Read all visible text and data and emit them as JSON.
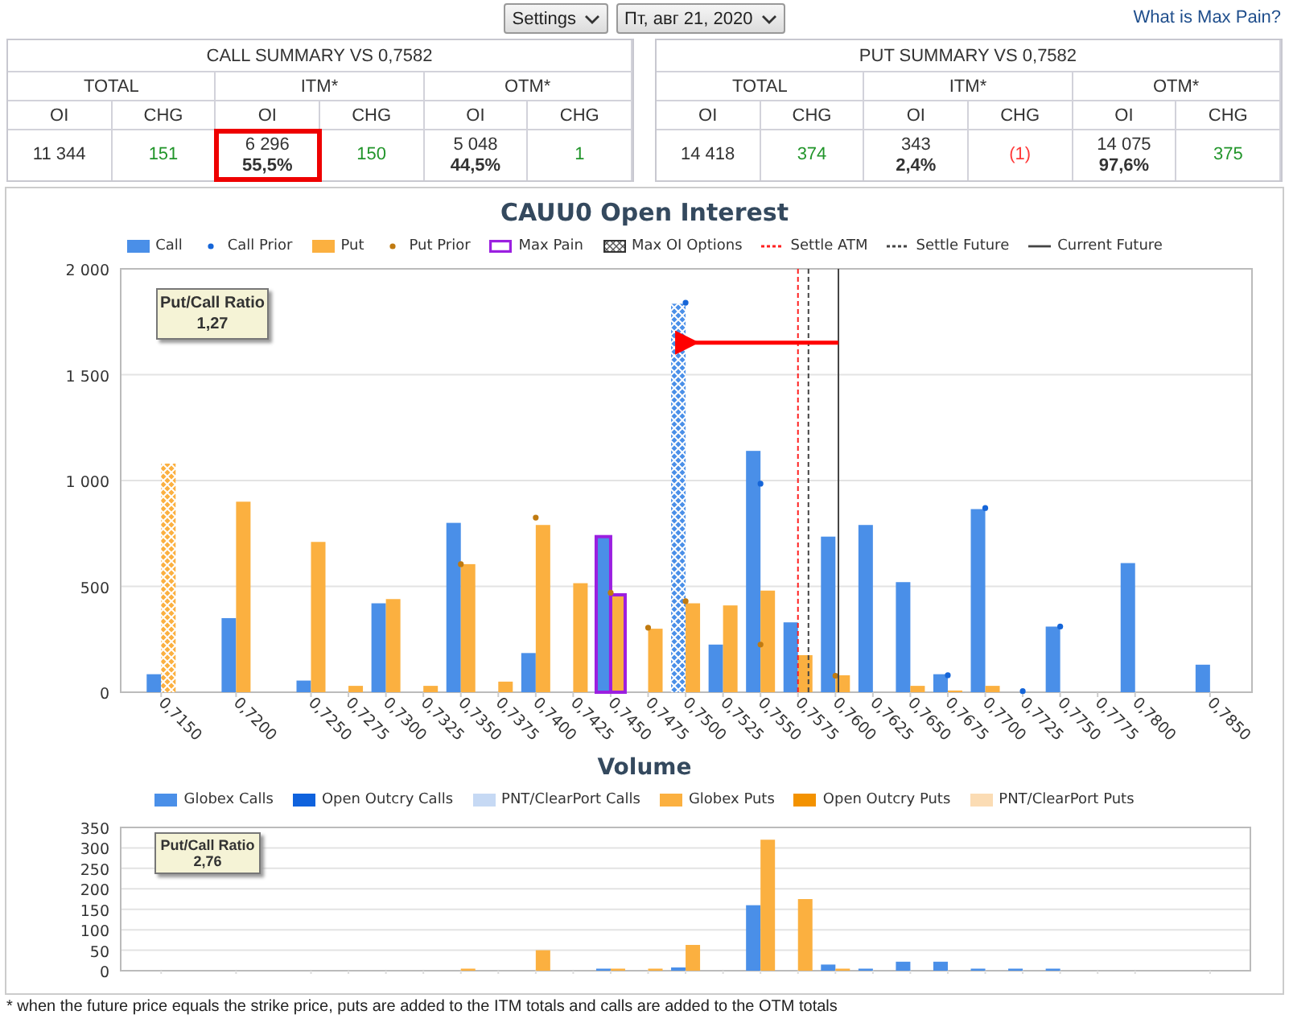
{
  "toolbar": {
    "settings": "Settings",
    "date": "Пт, авг 21, 2020",
    "help_link": "What is Max Pain?"
  },
  "summaries": [
    {
      "title": "CALL SUMMARY VS 0,7582",
      "groups": [
        "TOTAL",
        "ITM*",
        "OTM*"
      ],
      "columns": [
        "OI",
        "CHG",
        "OI",
        "CHG",
        "OI",
        "CHG"
      ],
      "cells": [
        {
          "value": "11 344",
          "color": "#333333",
          "highlighted": false
        },
        {
          "value": "151",
          "color": "#22952b",
          "highlighted": false
        },
        {
          "value": "6 296",
          "share": "55,5%",
          "color": "#333333",
          "highlighted": true
        },
        {
          "value": "150",
          "color": "#22952b",
          "highlighted": false
        },
        {
          "value": "5 048",
          "share": "44,5%",
          "color": "#333333",
          "highlighted": false
        },
        {
          "value": "1",
          "color": "#22952b",
          "highlighted": false
        }
      ]
    },
    {
      "title": "PUT SUMMARY VS 0,7582",
      "groups": [
        "TOTAL",
        "ITM*",
        "OTM*"
      ],
      "columns": [
        "OI",
        "CHG",
        "OI",
        "CHG",
        "OI",
        "CHG"
      ],
      "cells": [
        {
          "value": "14 418",
          "color": "#333333",
          "highlighted": false
        },
        {
          "value": "374",
          "color": "#22952b",
          "highlighted": false
        },
        {
          "value": "343",
          "share": "2,4%",
          "color": "#333333",
          "highlighted": false
        },
        {
          "value": "(1)",
          "color": "#ff3b3b",
          "highlighted": false
        },
        {
          "value": "14 075",
          "share": "97,6%",
          "color": "#333333",
          "highlighted": false
        },
        {
          "value": "375",
          "color": "#22952b",
          "highlighted": false
        }
      ]
    }
  ],
  "oi_chart": {
    "legend_extras": [
      {
        "label": "Max Pain",
        "kind": "outline",
        "color": "#9b1fe0"
      },
      {
        "label": "Max OI Options",
        "kind": "hatch",
        "color": "#333333"
      }
    ],
    "ratio": {
      "label": "Put/Call Ratio",
      "value": "1,27"
    },
    "chart_data": {
      "type": "bar",
      "title": "CAUU0 Open Interest",
      "stacked": false,
      "grid": true,
      "x": [
        0.715,
        0.72,
        0.725,
        0.7275,
        0.73,
        0.7325,
        0.735,
        0.7375,
        0.74,
        0.7425,
        0.745,
        0.7475,
        0.75,
        0.7525,
        0.755,
        0.7575,
        0.76,
        0.7625,
        0.765,
        0.7675,
        0.77,
        0.7725,
        0.775,
        0.7775,
        0.78,
        0.785
      ],
      "xlim": [
        0.7123,
        0.7878
      ],
      "xticks": [
        {
          "value": 0.715,
          "label": "0,7150"
        },
        {
          "value": 0.72,
          "label": "0,7200"
        },
        {
          "value": 0.725,
          "label": "0,7250"
        },
        {
          "value": 0.7275,
          "label": "0,7275"
        },
        {
          "value": 0.73,
          "label": "0,7300"
        },
        {
          "value": 0.7325,
          "label": "0,7325"
        },
        {
          "value": 0.735,
          "label": "0,7350"
        },
        {
          "value": 0.7375,
          "label": "0,7375"
        },
        {
          "value": 0.74,
          "label": "0,7400"
        },
        {
          "value": 0.7425,
          "label": "0,7425"
        },
        {
          "value": 0.745,
          "label": "0,7450"
        },
        {
          "value": 0.7475,
          "label": "0,7475"
        },
        {
          "value": 0.75,
          "label": "0,7500"
        },
        {
          "value": 0.7525,
          "label": "0,7525"
        },
        {
          "value": 0.755,
          "label": "0,7550"
        },
        {
          "value": 0.7575,
          "label": "0,7575"
        },
        {
          "value": 0.76,
          "label": "0,7600"
        },
        {
          "value": 0.7625,
          "label": "0,7625"
        },
        {
          "value": 0.765,
          "label": "0,7650"
        },
        {
          "value": 0.7675,
          "label": "0,7675"
        },
        {
          "value": 0.77,
          "label": "0,7700"
        },
        {
          "value": 0.7725,
          "label": "0,7725"
        },
        {
          "value": 0.775,
          "label": "0,7750"
        },
        {
          "value": 0.7775,
          "label": "0,7775"
        },
        {
          "value": 0.78,
          "label": "0,7800"
        },
        {
          "value": 0.785,
          "label": "0,7850"
        }
      ],
      "ylim": [
        0,
        2000
      ],
      "yticks": [
        {
          "value": 0,
          "label": "0"
        },
        {
          "value": 500,
          "label": "500"
        },
        {
          "value": 1000,
          "label": "1 000"
        },
        {
          "value": 1500,
          "label": "1 500"
        },
        {
          "value": 2000,
          "label": "2 000"
        }
      ],
      "series": [
        {
          "name": "Call",
          "type": "bar",
          "color": "#4a8fe8",
          "values": [
            85,
            350,
            55,
            0,
            420,
            0,
            800,
            0,
            185,
            0,
            735,
            0,
            1835,
            225,
            1140,
            330,
            735,
            790,
            520,
            85,
            865,
            0,
            310,
            0,
            610,
            130
          ]
        },
        {
          "name": "Call Prior",
          "type": "scatter",
          "color": "#1565d8",
          "values": [
            null,
            null,
            null,
            null,
            null,
            null,
            null,
            null,
            null,
            null,
            null,
            null,
            1840,
            null,
            985,
            null,
            null,
            null,
            null,
            80,
            870,
            5,
            310,
            null,
            null,
            null
          ]
        },
        {
          "name": "Put",
          "type": "bar",
          "color": "#fbb040",
          "values": [
            1080,
            900,
            710,
            30,
            440,
            30,
            605,
            50,
            790,
            515,
            460,
            300,
            420,
            410,
            480,
            175,
            80,
            0,
            30,
            8,
            30,
            0,
            0,
            0,
            0,
            0
          ]
        },
        {
          "name": "Put Prior",
          "type": "scatter",
          "color": "#c07a10",
          "values": [
            null,
            null,
            null,
            null,
            null,
            null,
            605,
            null,
            825,
            null,
            470,
            305,
            430,
            null,
            225,
            null,
            78,
            null,
            null,
            null,
            null,
            null,
            null,
            null,
            null,
            null
          ]
        }
      ],
      "ref_lines": [
        {
          "axis": "x",
          "value": 0.7575,
          "label": "Settle ATM",
          "color": "#ff2020"
        },
        {
          "axis": "x",
          "value": 0.7582,
          "label": "Settle Future",
          "color": "#444444"
        },
        {
          "axis": "x",
          "value": 0.7602,
          "label": "Current Future",
          "color": "#444444"
        }
      ]
    }
  },
  "volume_chart": {
    "ratio": {
      "label": "Put/Call Ratio",
      "value": "2,76"
    },
    "chart_data": {
      "type": "bar",
      "title": "Volume",
      "stacked": false,
      "grid": true,
      "x": [
        0.715,
        0.72,
        0.725,
        0.7275,
        0.73,
        0.7325,
        0.735,
        0.7375,
        0.74,
        0.7425,
        0.745,
        0.7475,
        0.75,
        0.7525,
        0.755,
        0.7575,
        0.76,
        0.7625,
        0.765,
        0.7675,
        0.77,
        0.7725,
        0.775,
        0.7775,
        0.78,
        0.785
      ],
      "xlim": [
        0.7123,
        0.7878
      ],
      "ylim": [
        0,
        350
      ],
      "yticks": [
        0,
        50,
        100,
        150,
        200,
        250,
        300,
        350
      ],
      "series": [
        {
          "name": "Globex Calls",
          "color": "#4a8fe8",
          "values": [
            0,
            0,
            0,
            0,
            0,
            0,
            0,
            0,
            0,
            0,
            5,
            0,
            8,
            0,
            160,
            0,
            15,
            5,
            22,
            22,
            5,
            5,
            5,
            0,
            0,
            0
          ]
        },
        {
          "name": "Open Outcry Calls",
          "color": "#0f62dd",
          "values": [
            0,
            0,
            0,
            0,
            0,
            0,
            0,
            0,
            0,
            0,
            0,
            0,
            0,
            0,
            0,
            0,
            0,
            0,
            0,
            0,
            0,
            0,
            0,
            0,
            0,
            0
          ]
        },
        {
          "name": "PNT/ClearPort Calls",
          "color": "#c6d9f4",
          "values": [
            0,
            0,
            0,
            0,
            0,
            0,
            0,
            0,
            0,
            0,
            0,
            0,
            0,
            0,
            0,
            0,
            0,
            0,
            0,
            0,
            0,
            0,
            0,
            0,
            0,
            0
          ]
        },
        {
          "name": "Globex Puts",
          "color": "#fbb040",
          "values": [
            0,
            0,
            0,
            0,
            0,
            0,
            5,
            0,
            50,
            0,
            5,
            5,
            63,
            0,
            320,
            175,
            5,
            0,
            0,
            0,
            0,
            0,
            0,
            0,
            0,
            0
          ]
        },
        {
          "name": "Open Outcry Puts",
          "color": "#f39200",
          "values": [
            0,
            0,
            0,
            0,
            0,
            0,
            0,
            0,
            0,
            0,
            0,
            0,
            0,
            0,
            0,
            0,
            0,
            0,
            0,
            0,
            0,
            0,
            0,
            0,
            0,
            0
          ]
        },
        {
          "name": "PNT/ClearPort Puts",
          "color": "#fbdcb4",
          "values": [
            0,
            0,
            0,
            0,
            0,
            0,
            0,
            0,
            0,
            0,
            0,
            0,
            0,
            0,
            0,
            0,
            0,
            0,
            0,
            0,
            0,
            0,
            0,
            0,
            0,
            0
          ]
        }
      ]
    }
  },
  "footnote": "* when the future price equals the strike price, puts are added to the ITM totals and calls are added to the OTM totals"
}
